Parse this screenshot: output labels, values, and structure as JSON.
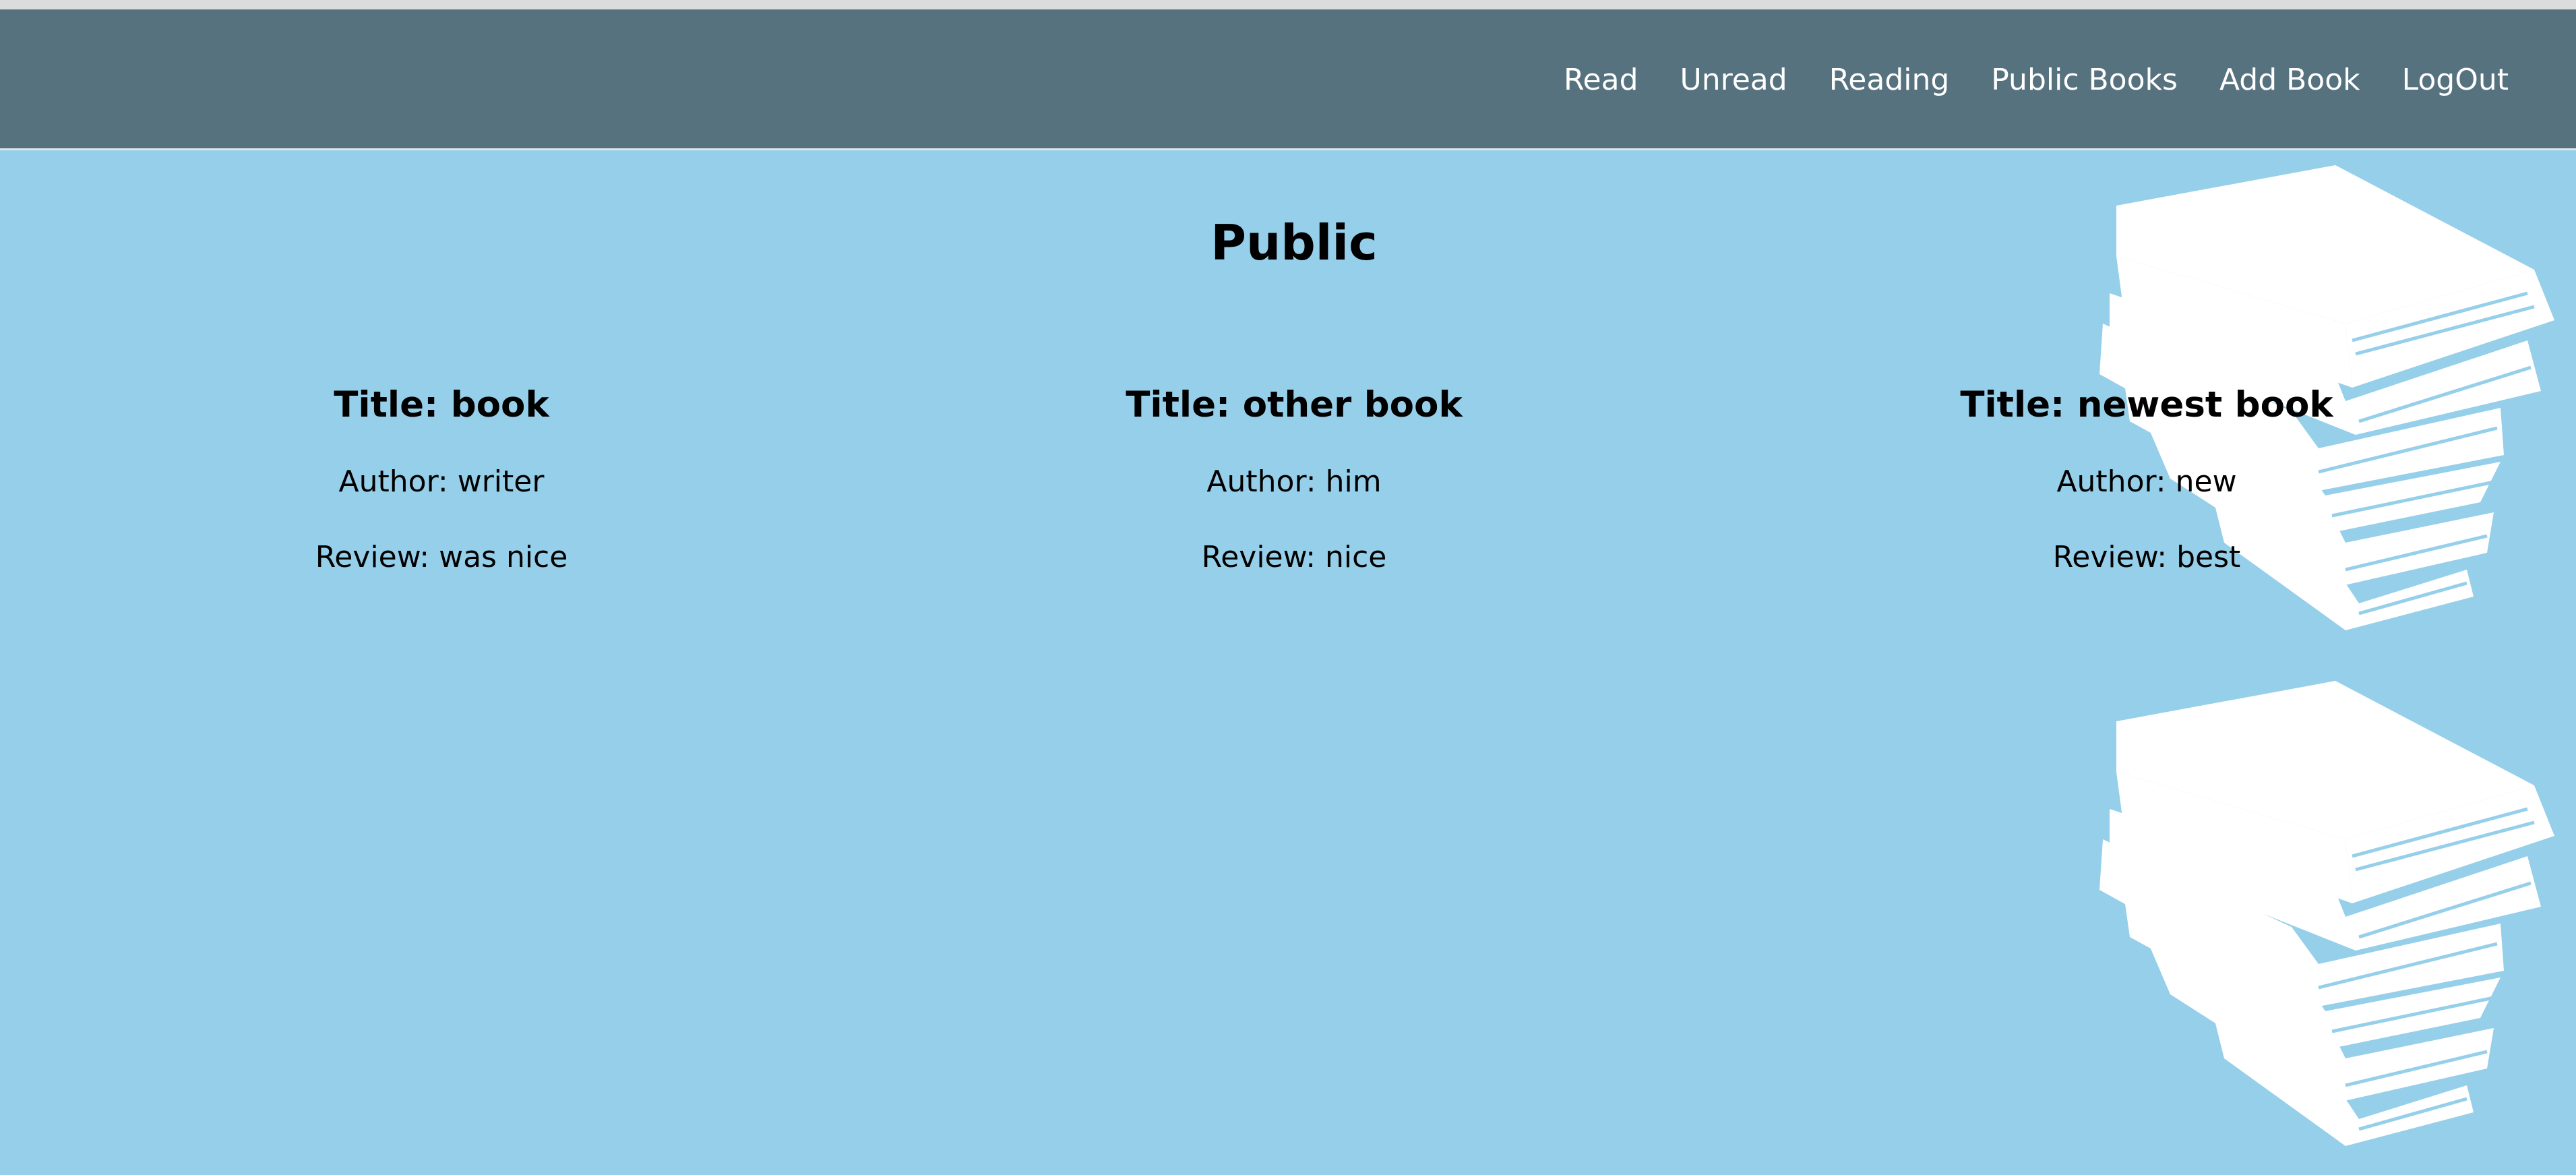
{
  "nav": {
    "items": [
      {
        "label": "Read"
      },
      {
        "label": "Unread"
      },
      {
        "label": "Reading"
      },
      {
        "label": "Public Books"
      },
      {
        "label": "Add Book"
      },
      {
        "label": "LogOut"
      }
    ]
  },
  "main": {
    "title": "Public",
    "books": [
      {
        "title": "Title: book",
        "author": "Author: writer",
        "review": "Review: was nice"
      },
      {
        "title": "Title: other book",
        "author": "Author: him",
        "review": "Review: nice"
      },
      {
        "title": "Title: newest book",
        "author": "Author: new",
        "review": "Review: best"
      }
    ]
  },
  "theme": {
    "navbar_color": "#56727e",
    "background_color": "#96cfea",
    "nav_text_color": "#ffffff"
  },
  "decoration": {
    "icon": "stack-of-books-icon"
  }
}
